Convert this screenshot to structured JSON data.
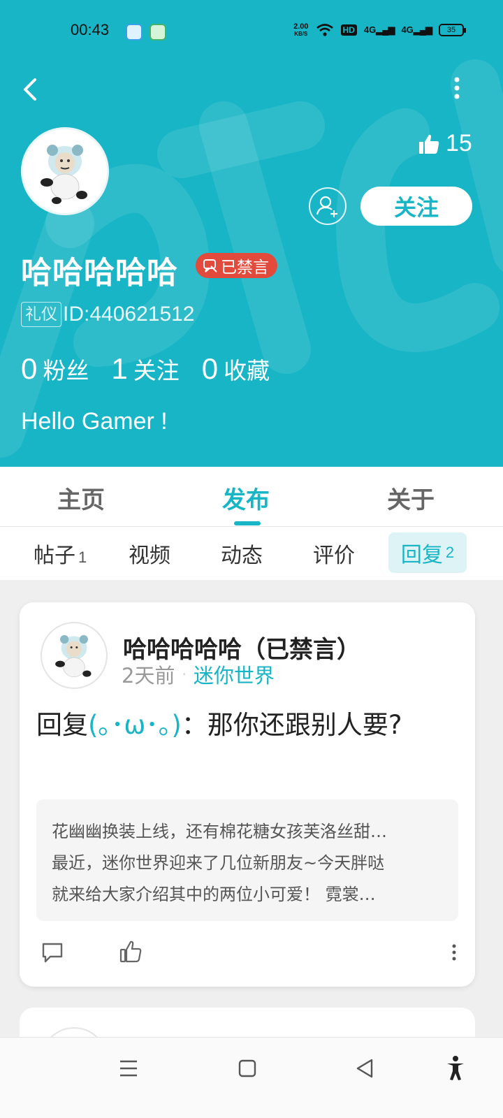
{
  "status_bar": {
    "time": "00:43",
    "net_speed_value": "2.00",
    "net_speed_unit": "KB/S",
    "hd_label": "HD",
    "signal1": "4G",
    "signal2": "4G",
    "battery": "35"
  },
  "profile": {
    "likes_count": "15",
    "follow_label": "关注",
    "username": "哈哈哈哈哈",
    "banned_label": "已禁言",
    "etiquette_label": "礼仪",
    "user_id": "ID:440621512",
    "stats": [
      {
        "num": "0",
        "label": "粉丝"
      },
      {
        "num": "1",
        "label": "关注"
      },
      {
        "num": "0",
        "label": "收藏"
      }
    ],
    "bio": "Hello Gamer !"
  },
  "main_tabs": [
    {
      "label": "主页"
    },
    {
      "label": "发布"
    },
    {
      "label": "关于"
    }
  ],
  "sub_tabs": [
    {
      "label": "帖子",
      "count": "1"
    },
    {
      "label": "视频",
      "count": ""
    },
    {
      "label": "动态",
      "count": ""
    },
    {
      "label": "评价",
      "count": ""
    },
    {
      "label": "回复",
      "count": "2"
    }
  ],
  "post": {
    "author": "哈哈哈哈哈（已禁言）",
    "time": "2天前",
    "dot": "·",
    "game": "迷你世界",
    "reply_prefix": "回复",
    "reply_to": "(｡･ω･｡)",
    "reply_text": "：那你还跟别人要?",
    "quote_lines": [
      "花幽幽换装上线，还有棉花糖女孩芙洛丝甜…",
      "最近，迷你世界迎来了几位新朋友~今天胖哒",
      "就来给大家介绍其中的两位小可爱！  霓裳…"
    ]
  },
  "colors": {
    "accent": "#17b5c6",
    "banned": "#e24a3b"
  },
  "icons": {
    "back": "back-arrow-icon",
    "more": "more-vertical-icon",
    "like": "thumbs-up-icon",
    "add_friend": "add-user-icon",
    "comment": "comment-icon",
    "nav_menu": "menu-icon",
    "nav_home": "square-home-icon",
    "nav_back": "triangle-back-icon",
    "accessibility": "accessibility-icon"
  }
}
